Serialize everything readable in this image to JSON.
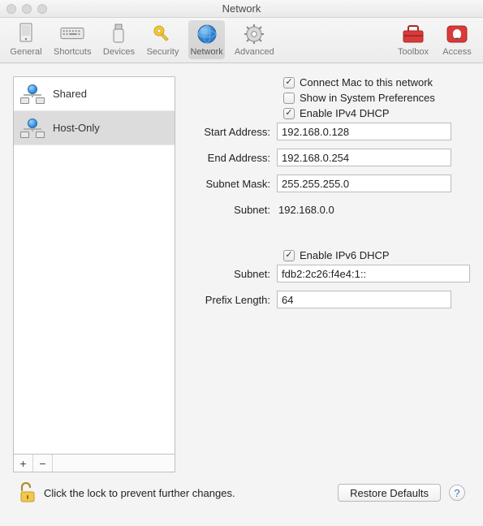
{
  "window": {
    "title": "Network"
  },
  "toolbar": {
    "left": [
      {
        "label": "General",
        "name": "toolbar-general"
      },
      {
        "label": "Shortcuts",
        "name": "toolbar-shortcuts"
      },
      {
        "label": "Devices",
        "name": "toolbar-devices"
      },
      {
        "label": "Security",
        "name": "toolbar-security"
      },
      {
        "label": "Network",
        "name": "toolbar-network"
      },
      {
        "label": "Advanced",
        "name": "toolbar-advanced"
      }
    ],
    "right": [
      {
        "label": "Toolbox",
        "name": "toolbar-toolbox"
      },
      {
        "label": "Access",
        "name": "toolbar-access"
      }
    ]
  },
  "sidebar": {
    "items": [
      {
        "label": "Shared"
      },
      {
        "label": "Host-Only"
      }
    ],
    "add": "+",
    "remove": "−"
  },
  "form": {
    "connect_mac": "Connect Mac to this network",
    "show_sys_prefs": "Show in System Preferences",
    "enable_dhcp4": "Enable IPv4 DHCP",
    "start_label": "Start Address:",
    "start_value": "192.168.0.128",
    "end_label": "End Address:",
    "end_value": "192.168.0.254",
    "mask_label": "Subnet Mask:",
    "mask_value": "255.255.255.0",
    "subnet_label": "Subnet:",
    "subnet_value": "192.168.0.0",
    "enable_dhcp6": "Enable IPv6 DHCP",
    "subnet6_label": "Subnet:",
    "subnet6_value": "fdb2:2c26:f4e4:1::",
    "prefix_label": "Prefix Length:",
    "prefix_value": "64"
  },
  "footer": {
    "lock_text": "Click the lock to prevent further changes.",
    "restore": "Restore Defaults",
    "help": "?"
  }
}
